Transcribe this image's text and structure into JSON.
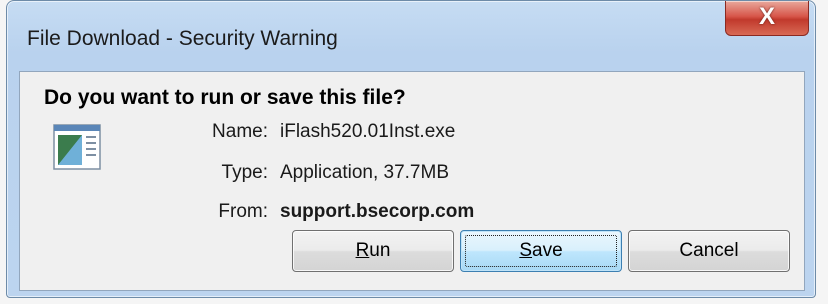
{
  "window": {
    "title": "File Download - Security Warning",
    "close_glyph": "X"
  },
  "dialog": {
    "question": "Do you want to run or save this file?",
    "icon": "application-window-icon",
    "fields": [
      {
        "label": "Name:",
        "value": "iFlash520.01Inst.exe",
        "bold": false
      },
      {
        "label": "Type:",
        "value": "Application, 37.7MB",
        "bold": false
      },
      {
        "label": "From:",
        "value": "support.bsecorp.com",
        "bold": true
      }
    ]
  },
  "buttons": {
    "run": {
      "mnemonic": "R",
      "rest": "un"
    },
    "save": {
      "mnemonic": "S",
      "rest": "ave"
    },
    "cancel": {
      "label": "Cancel"
    }
  },
  "colors": {
    "accent": "#3c7fb1",
    "close_red": "#c1392c",
    "frame_blue": "#bcd4ef"
  }
}
